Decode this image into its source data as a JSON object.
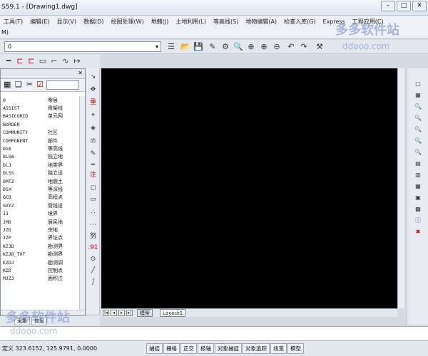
{
  "window": {
    "title": "S59.1 - [Drawing1.dwg]",
    "controls": [
      "–",
      "□",
      "✕"
    ]
  },
  "menu": {
    "items": [
      "工具(T)",
      "编辑(E)",
      "显示(V)",
      "数据(D)",
      "绘图处理(W)",
      "地籍(J)",
      "土地利用(L)",
      "等高线(S)",
      "地物编辑(A)",
      "检查入库(G)",
      "Express",
      "工程应用(C)"
    ],
    "line2": "M)"
  },
  "toolbar": {
    "layer_value": "0"
  },
  "left_panel": {
    "layers": [
      {
        "code": "0",
        "name": "零层"
      },
      {
        "code": "ASSIST",
        "name": "骨架线"
      },
      {
        "code": "BASICGRID",
        "name": "单元网"
      },
      {
        "code": "BORDER",
        "name": ""
      },
      {
        "code": "COMMUNITY",
        "name": "社区"
      },
      {
        "code": "COMPONENT",
        "name": "部件"
      },
      {
        "code": "DGX",
        "name": "等高线"
      },
      {
        "code": "DLSW",
        "name": "独立地"
      },
      {
        "code": "DLJ",
        "name": "地类界"
      },
      {
        "code": "DLSS",
        "name": "独立设"
      },
      {
        "code": "DMTZ",
        "name": "地貌土"
      },
      {
        "code": "DSX",
        "name": "等深线"
      },
      {
        "code": "GCD",
        "name": "高程点"
      },
      {
        "code": "GXYZ",
        "name": "管线设"
      },
      {
        "code": "JJ",
        "name": "境界"
      },
      {
        "code": "JMD",
        "name": "居民地"
      },
      {
        "code": "JZD",
        "name": "宗地"
      },
      {
        "code": "JZP",
        "name": "界址点"
      },
      {
        "code": "KZJD",
        "name": "勘测界"
      },
      {
        "code": "KZJD_TXT",
        "name": "勘测界"
      },
      {
        "code": "KZDJ",
        "name": "勘测调"
      },
      {
        "code": "KZD",
        "name": "控制点"
      },
      {
        "code": "MJZJ",
        "name": "面积注"
      }
    ],
    "tabs": [
      "采集",
      "信息"
    ]
  },
  "canvas": {
    "layout_tabs": [
      "模型",
      "Layout1"
    ]
  },
  "status": {
    "coords": "323.6152, 125.9791, 0.0000",
    "coords_label": "定义",
    "buttons": [
      "捕捉",
      "栅格",
      "正交",
      "极轴",
      "对象捕捉",
      "对象追踪",
      "线宽",
      "模型"
    ]
  },
  "watermark": {
    "text_main": "多多软件站",
    "text_url": "ddooo.com"
  }
}
